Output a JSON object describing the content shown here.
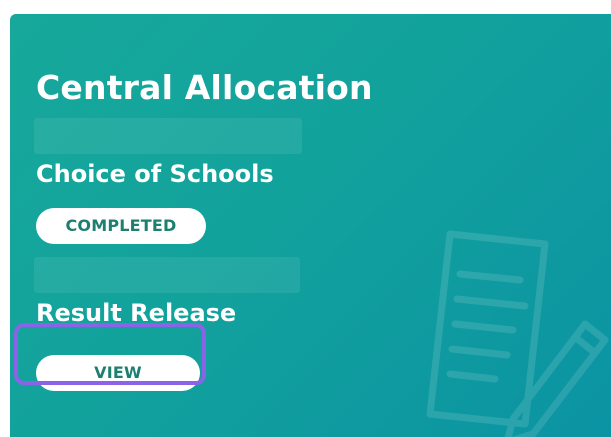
{
  "card": {
    "title": "Central Allocation",
    "stages": [
      {
        "label": "Choice of Schools",
        "action": "COMPLETED"
      },
      {
        "label": "Result Release",
        "action": "VIEW"
      }
    ]
  },
  "icons": {
    "background": "document-pencil-icon"
  },
  "colors": {
    "card_gradient_start": "#17a89b",
    "card_gradient_end": "#0b93a3",
    "pill_text": "#1c7f6f",
    "highlight": "#8a63e6"
  }
}
